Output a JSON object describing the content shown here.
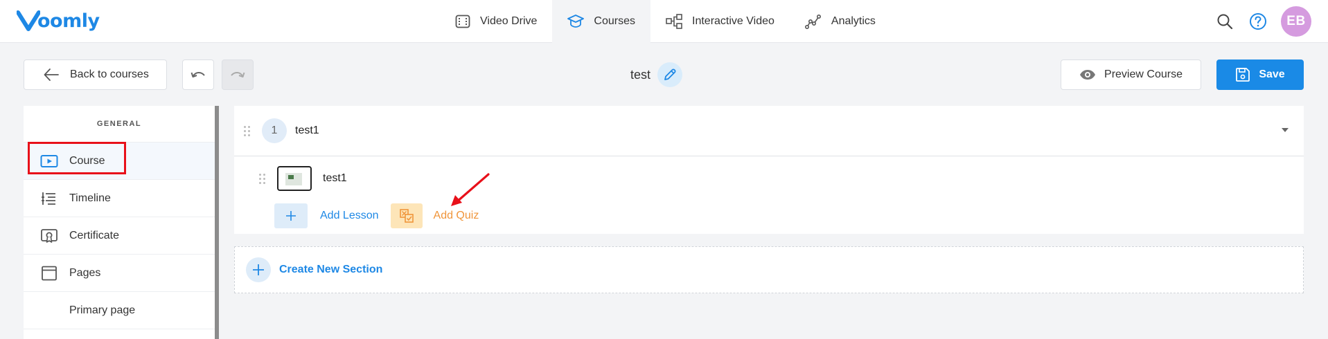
{
  "app": {
    "logo_text": "oomly"
  },
  "nav": {
    "items": [
      {
        "label": "Video Drive",
        "icon": "film-icon",
        "active": false
      },
      {
        "label": "Courses",
        "icon": "graduation-cap-icon",
        "active": true
      },
      {
        "label": "Interactive Video",
        "icon": "flow-diagram-icon",
        "active": false
      },
      {
        "label": "Analytics",
        "icon": "line-chart-icon",
        "active": false
      }
    ]
  },
  "user": {
    "initials": "EB",
    "avatar_color": "#d59bdf"
  },
  "toolbar": {
    "back_label": "Back to courses",
    "course_title": "test",
    "preview_label": "Preview Course",
    "save_label": "Save"
  },
  "sidebar": {
    "header": "GENERAL",
    "items": [
      {
        "label": "Course",
        "icon": "video-play-icon",
        "active": true
      },
      {
        "label": "Timeline",
        "icon": "timeline-list-icon",
        "active": false
      },
      {
        "label": "Certificate",
        "icon": "certificate-icon",
        "active": false
      },
      {
        "label": "Pages",
        "icon": "page-icon",
        "active": false
      },
      {
        "label": "Primary page",
        "icon": "",
        "active": false
      }
    ]
  },
  "section": {
    "number": "1",
    "name": "test1",
    "lessons": [
      {
        "name": "test1"
      }
    ],
    "add_lesson_label": "Add Lesson",
    "add_quiz_label": "Add Quiz"
  },
  "create_section_label": "Create New Section",
  "colors": {
    "accent": "#1a8ae6",
    "quiz": "#f0953a",
    "annotation": "#e8101a"
  }
}
